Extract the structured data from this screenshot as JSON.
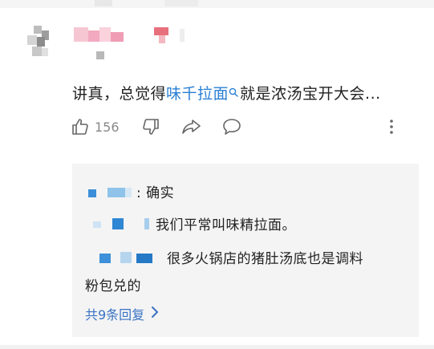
{
  "comment": {
    "text_before": "讲真，总觉得",
    "link_text": "味千拉面",
    "text_after": "就是浓汤宝开大会...",
    "like_count": "156",
    "icons": [
      "thumbs-up-icon",
      "thumbs-down-icon",
      "share-icon",
      "comment-icon",
      "more-icon",
      "search-icon"
    ]
  },
  "replies": [
    {
      "text": ": 确实"
    },
    {
      "text": "我们平常叫味精拉面。"
    },
    {
      "text_line1": "很多火锅店的猪肚汤底也是调料",
      "text_line2": "粉包兑的"
    }
  ],
  "more_replies_label": "共9条回复",
  "colors": {
    "link": "#2a7fd4",
    "more_replies": "#3a73c4",
    "reply_bg": "#f4f4f4"
  }
}
